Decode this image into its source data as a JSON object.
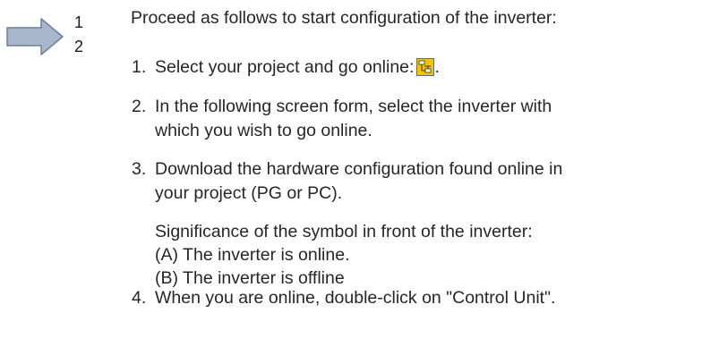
{
  "step_marker": {
    "icon": "arrow-right-icon",
    "numbers": [
      "1",
      "2"
    ]
  },
  "intro": "Proceed as follows to start configuration of the inverter:",
  "steps": [
    {
      "number": "1.",
      "lines": [
        "Select your project and go online:"
      ],
      "trailing_icon": "go-online-icon",
      "trailing_text": "."
    },
    {
      "number": "2.",
      "lines": [
        "In the following screen form, select the inverter with",
        "which you wish to go online."
      ]
    },
    {
      "number": "3.",
      "lines": [
        "Download the hardware configuration found online in",
        "your project (PG or PC)."
      ],
      "sub_lines": [
        "Significance of the symbol in front of the inverter:",
        "(A) The inverter is online.",
        "(B) The inverter is offline"
      ]
    },
    {
      "number": "4.",
      "lines": [
        "When you are online, double-click on \"Control Unit\"."
      ]
    }
  ],
  "colors": {
    "arrow_fill": "#a8b8cc",
    "arrow_stroke": "#6e7f96",
    "icon_fill": "#f5c400",
    "icon_border": "#5a6f8c",
    "text": "#262626"
  }
}
